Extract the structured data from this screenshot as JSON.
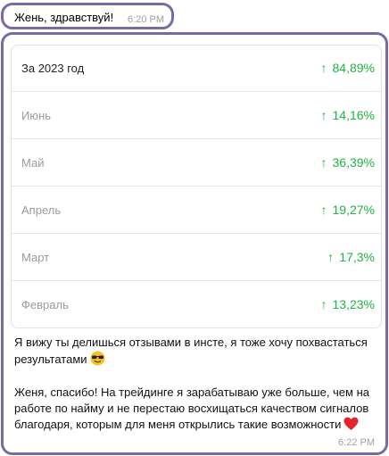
{
  "messages": {
    "first": {
      "text": "Жень, здравствуй!",
      "time": "6:20 PM"
    },
    "second": {
      "time": "6:22 PM",
      "results": [
        {
          "period": "За 2023 год",
          "change": "84,89%",
          "direction": "up"
        },
        {
          "period": "Июнь",
          "change": "14,16%",
          "direction": "up"
        },
        {
          "period": "Май",
          "change": "36,39%",
          "direction": "up"
        },
        {
          "period": "Апрель",
          "change": "19,27%",
          "direction": "up"
        },
        {
          "period": "Март",
          "change": "17,3%",
          "direction": "up"
        },
        {
          "period": "Февраль",
          "change": "13,23%",
          "direction": "up"
        }
      ],
      "paragraph_1": "Я вижу ты делишься отзывами в инсте, я тоже хочу похвастаться результатами",
      "paragraph_2": "Женя, спасибо! На трейдинге я зарабатываю уже больше, чем на работе по найму и не перестаю восхищаться качеством сигналов благодаря, которым для меня открылись такие возможности",
      "emoji_1": "sunglasses-emoji",
      "emoji_2": "red-heart-emoji"
    }
  },
  "colors": {
    "bubble_border": "#7a6aa3",
    "positive": "#1fb544",
    "time": "#a0a0a8"
  },
  "icons": {
    "up_arrow": "arrow-up-icon"
  }
}
